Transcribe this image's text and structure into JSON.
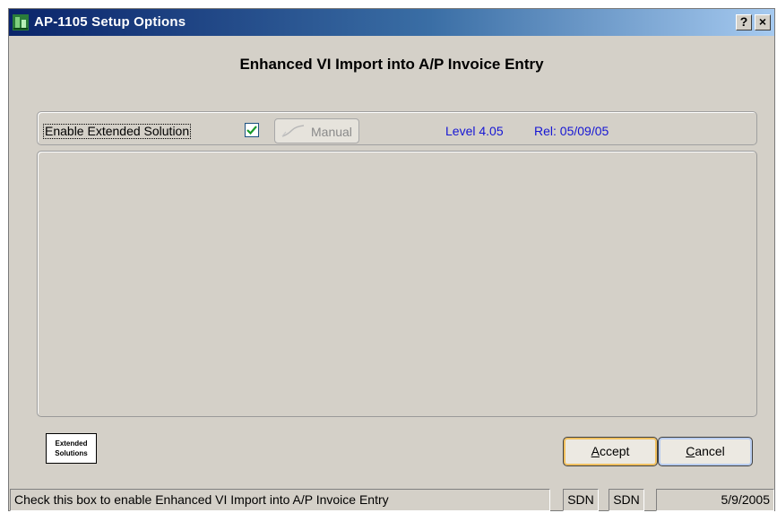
{
  "window": {
    "title": "AP-1105 Setup Options",
    "help_button": "?",
    "close_button": "×"
  },
  "heading": "Enhanced VI Import into A/P Invoice Entry",
  "options": {
    "enable_label": "Enable Extended Solution",
    "enable_checked": true,
    "manual_label": "Manual",
    "level": "Level 4.05",
    "release": "Rel: 05/09/05"
  },
  "logo": {
    "line1": "Extended",
    "line2": "Solutions"
  },
  "buttons": {
    "accept": {
      "mnemonic": "A",
      "rest": "ccept"
    },
    "cancel": {
      "mnemonic": "C",
      "rest": "ancel"
    }
  },
  "status": {
    "message": "Check this box to enable Enhanced VI Import into A/P Invoice Entry",
    "user1": "SDN",
    "user2": "SDN",
    "date": "5/9/2005"
  },
  "colors": {
    "title_start": "#0a246a",
    "title_end": "#a6caf0",
    "info_text": "#1616d4",
    "face": "#d4d0c8"
  }
}
